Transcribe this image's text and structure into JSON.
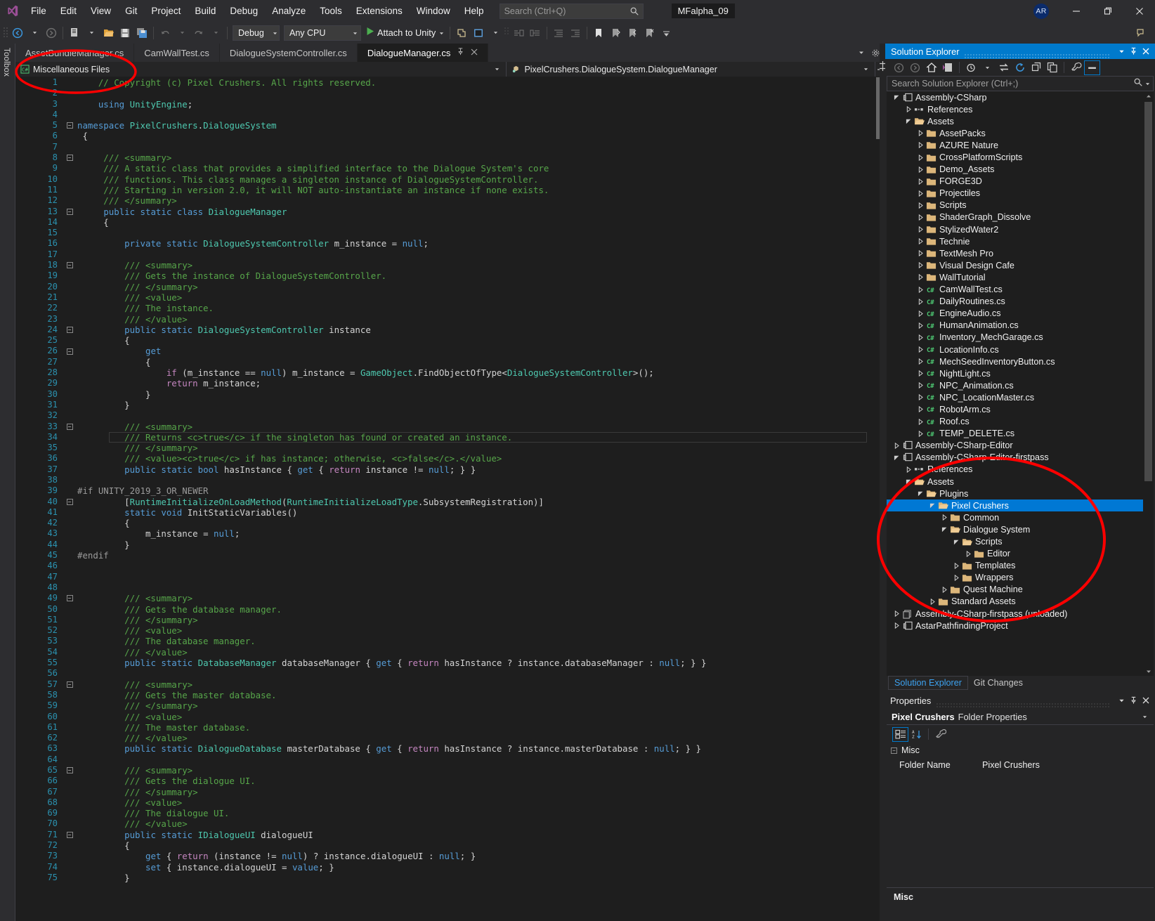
{
  "app": {
    "logo": "visual-studio-logo",
    "solution_name": "MFalpha_09",
    "avatar_initials": "AR"
  },
  "menu": {
    "items": [
      "File",
      "Edit",
      "View",
      "Git",
      "Project",
      "Build",
      "Debug",
      "Analyze",
      "Tools",
      "Extensions",
      "Window",
      "Help"
    ]
  },
  "search": {
    "placeholder": "Search (Ctrl+Q)",
    "value": "",
    "icon": "search-icon"
  },
  "window_controls": {
    "minimize": "—",
    "restore": "❐",
    "close": "✕"
  },
  "toolbar": {
    "nav_back": "navigate-back-icon",
    "nav_forward": "navigate-forward-icon",
    "new_item": "new-item-icon",
    "open_file": "open-file-icon",
    "save": "save-icon",
    "save_all": "save-all-icon",
    "undo": "undo-icon",
    "redo": "redo-icon",
    "config": "Debug",
    "platform": "Any CPU",
    "run_label": "Attach to Unity",
    "run_icon": "play-icon",
    "live_share": "live-share-icon",
    "preview": "preview-icon",
    "comment": "comment-icon",
    "uncomment": "uncomment-icon",
    "indent": "indent-icon",
    "outdent": "outdent-icon",
    "bookmark": "bookmark-icon",
    "bookmark_prev": "bookmark-prev-icon",
    "bookmark_next": "bookmark-next-icon",
    "bookmark_clear": "bookmark-clear-icon",
    "feedback": "feedback-icon"
  },
  "toolbox": {
    "label": "Toolbox"
  },
  "editor": {
    "tabs": [
      {
        "label": "AssetBundleManager.cs",
        "active": false
      },
      {
        "label": "CamWallTest.cs",
        "active": false
      },
      {
        "label": "DialogueSystemController.cs",
        "active": false
      },
      {
        "label": "DialogueManager.cs",
        "active": true
      }
    ],
    "tab_pin": "─□",
    "tab_close": "✕",
    "navbar": {
      "project": "Miscellaneous Files",
      "project_icon": "csharp-file-icon",
      "type": "PixelCrushers.DialogueSystem.DialogueManager",
      "type_icon": "class-icon"
    },
    "current_line": 34,
    "lines": [
      {
        "n": 1,
        "fold": "",
        "text": "    // Copyright (c) Pixel Crushers. All rights reserved.",
        "style": "cmt"
      },
      {
        "n": 2,
        "fold": "",
        "text": "",
        "style": "plain"
      },
      {
        "n": 3,
        "fold": "",
        "text": "    using UnityEngine;",
        "style": "mix"
      },
      {
        "n": 4,
        "fold": "",
        "text": "",
        "style": "plain"
      },
      {
        "n": 5,
        "fold": "-",
        "text": "namespace PixelCrushers.DialogueSystem",
        "style": "mix"
      },
      {
        "n": 6,
        "fold": "",
        "text": " {",
        "style": "plain"
      },
      {
        "n": 7,
        "fold": "",
        "text": "",
        "style": "plain"
      },
      {
        "n": 8,
        "fold": "-",
        "text": "     /// <summary>",
        "style": "doc"
      },
      {
        "n": 9,
        "fold": "",
        "text": "     /// A static class that provides a simplified interface to the Dialogue System's core",
        "style": "doc"
      },
      {
        "n": 10,
        "fold": "",
        "text": "     /// functions. This class manages a singleton instance of DialogueSystemController.",
        "style": "doc"
      },
      {
        "n": 11,
        "fold": "",
        "text": "     /// Starting in version 2.0, it will NOT auto-instantiate an instance if none exists.",
        "style": "doc"
      },
      {
        "n": 12,
        "fold": "",
        "text": "     /// </summary>",
        "style": "doc"
      },
      {
        "n": 13,
        "fold": "-",
        "text": "     public static class DialogueManager",
        "style": "mix"
      },
      {
        "n": 14,
        "fold": "",
        "text": "     {",
        "style": "plain"
      },
      {
        "n": 15,
        "fold": "",
        "text": "",
        "style": "plain"
      },
      {
        "n": 16,
        "fold": "",
        "text": "         private static DialogueSystemController m_instance = null;",
        "style": "mix"
      },
      {
        "n": 17,
        "fold": "",
        "text": "",
        "style": "plain"
      },
      {
        "n": 18,
        "fold": "-",
        "text": "         /// <summary>",
        "style": "doc"
      },
      {
        "n": 19,
        "fold": "",
        "text": "         /// Gets the instance of DialogueSystemController.",
        "style": "doc"
      },
      {
        "n": 20,
        "fold": "",
        "text": "         /// </summary>",
        "style": "doc"
      },
      {
        "n": 21,
        "fold": "",
        "text": "         /// <value>",
        "style": "doc"
      },
      {
        "n": 22,
        "fold": "",
        "text": "         /// The instance.",
        "style": "doc"
      },
      {
        "n": 23,
        "fold": "",
        "text": "         /// </value>",
        "style": "doc"
      },
      {
        "n": 24,
        "fold": "-",
        "text": "         public static DialogueSystemController instance",
        "style": "mix"
      },
      {
        "n": 25,
        "fold": "",
        "text": "         {",
        "style": "plain"
      },
      {
        "n": 26,
        "fold": "-",
        "text": "             get",
        "style": "mix"
      },
      {
        "n": 27,
        "fold": "",
        "text": "             {",
        "style": "plain"
      },
      {
        "n": 28,
        "fold": "",
        "text": "                 if (m_instance == null) m_instance = GameObject.FindObjectOfType<DialogueSystemController>();",
        "style": "mix"
      },
      {
        "n": 29,
        "fold": "",
        "text": "                 return m_instance;",
        "style": "mix"
      },
      {
        "n": 30,
        "fold": "",
        "text": "             }",
        "style": "plain"
      },
      {
        "n": 31,
        "fold": "",
        "text": "         }",
        "style": "plain"
      },
      {
        "n": 32,
        "fold": "",
        "text": "",
        "style": "plain"
      },
      {
        "n": 33,
        "fold": "-",
        "text": "         /// <summary>",
        "style": "doc"
      },
      {
        "n": 34,
        "fold": "",
        "text": "         /// Returns <c>true</c> if the singleton has found or created an instance.",
        "style": "doc"
      },
      {
        "n": 35,
        "fold": "",
        "text": "         /// </summary>",
        "style": "doc"
      },
      {
        "n": 36,
        "fold": "",
        "text": "         /// <value><c>true</c> if has instance; otherwise, <c>false</c>.</value>",
        "style": "doc"
      },
      {
        "n": 37,
        "fold": "",
        "text": "         public static bool hasInstance { get { return instance != null; } }",
        "style": "mix"
      },
      {
        "n": 38,
        "fold": "",
        "text": "",
        "style": "plain"
      },
      {
        "n": 39,
        "fold": "",
        "text": "#if UNITY_2019_3_OR_NEWER",
        "style": "pp"
      },
      {
        "n": 40,
        "fold": "-",
        "text": "         [RuntimeInitializeOnLoadMethod(RuntimeInitializeLoadType.SubsystemRegistration)]",
        "style": "mix"
      },
      {
        "n": 41,
        "fold": "",
        "text": "         static void InitStaticVariables()",
        "style": "mix"
      },
      {
        "n": 42,
        "fold": "",
        "text": "         {",
        "style": "plain"
      },
      {
        "n": 43,
        "fold": "",
        "text": "             m_instance = null;",
        "style": "mix"
      },
      {
        "n": 44,
        "fold": "",
        "text": "         }",
        "style": "plain"
      },
      {
        "n": 45,
        "fold": "",
        "text": "#endif",
        "style": "pp"
      },
      {
        "n": 46,
        "fold": "",
        "text": "",
        "style": "plain"
      },
      {
        "n": 47,
        "fold": "",
        "text": "",
        "style": "plain"
      },
      {
        "n": 48,
        "fold": "",
        "text": "",
        "style": "plain"
      },
      {
        "n": 49,
        "fold": "-",
        "text": "         /// <summary>",
        "style": "doc"
      },
      {
        "n": 50,
        "fold": "",
        "text": "         /// Gets the database manager.",
        "style": "doc"
      },
      {
        "n": 51,
        "fold": "",
        "text": "         /// </summary>",
        "style": "doc"
      },
      {
        "n": 52,
        "fold": "",
        "text": "         /// <value>",
        "style": "doc"
      },
      {
        "n": 53,
        "fold": "",
        "text": "         /// The database manager.",
        "style": "doc"
      },
      {
        "n": 54,
        "fold": "",
        "text": "         /// </value>",
        "style": "doc"
      },
      {
        "n": 55,
        "fold": "",
        "text": "         public static DatabaseManager databaseManager { get { return hasInstance ? instance.databaseManager : null; } }",
        "style": "mix"
      },
      {
        "n": 56,
        "fold": "",
        "text": "",
        "style": "plain"
      },
      {
        "n": 57,
        "fold": "-",
        "text": "         /// <summary>",
        "style": "doc"
      },
      {
        "n": 58,
        "fold": "",
        "text": "         /// Gets the master database.",
        "style": "doc"
      },
      {
        "n": 59,
        "fold": "",
        "text": "         /// </summary>",
        "style": "doc"
      },
      {
        "n": 60,
        "fold": "",
        "text": "         /// <value>",
        "style": "doc"
      },
      {
        "n": 61,
        "fold": "",
        "text": "         /// The master database.",
        "style": "doc"
      },
      {
        "n": 62,
        "fold": "",
        "text": "         /// </value>",
        "style": "doc"
      },
      {
        "n": 63,
        "fold": "",
        "text": "         public static DialogueDatabase masterDatabase { get { return hasInstance ? instance.masterDatabase : null; } }",
        "style": "mix"
      },
      {
        "n": 64,
        "fold": "",
        "text": "",
        "style": "plain"
      },
      {
        "n": 65,
        "fold": "-",
        "text": "         /// <summary>",
        "style": "doc"
      },
      {
        "n": 66,
        "fold": "",
        "text": "         /// Gets the dialogue UI.",
        "style": "doc"
      },
      {
        "n": 67,
        "fold": "",
        "text": "         /// </summary>",
        "style": "doc"
      },
      {
        "n": 68,
        "fold": "",
        "text": "         /// <value>",
        "style": "doc"
      },
      {
        "n": 69,
        "fold": "",
        "text": "         /// The dialogue UI.",
        "style": "doc"
      },
      {
        "n": 70,
        "fold": "",
        "text": "         /// </value>",
        "style": "doc"
      },
      {
        "n": 71,
        "fold": "-",
        "text": "         public static IDialogueUI dialogueUI",
        "style": "mix"
      },
      {
        "n": 72,
        "fold": "",
        "text": "         {",
        "style": "plain"
      },
      {
        "n": 73,
        "fold": "",
        "text": "             get { return (instance != null) ? instance.dialogueUI : null; }",
        "style": "mix"
      },
      {
        "n": 74,
        "fold": "",
        "text": "             set { instance.dialogueUI = value; }",
        "style": "mix"
      },
      {
        "n": 75,
        "fold": "",
        "text": "         }",
        "style": "plain"
      }
    ]
  },
  "solution_explorer": {
    "title": "Solution Explorer",
    "header_buttons": [
      "chevron-down-icon",
      "pin-icon",
      "close-icon"
    ],
    "toolbar_icons": [
      "back-icon",
      "forward-icon",
      "home-icon",
      "sync-with-active-document-icon",
      "pending-changes-filter-icon",
      "sync-icon",
      "refresh-icon",
      "collapse-all-icon",
      "show-all-files-icon",
      "properties-icon",
      "preview-selected-items-icon"
    ],
    "search_placeholder": "Search Solution Explorer (Ctrl+;)",
    "search_value": "",
    "search_icon": "search-icon",
    "tree": [
      {
        "depth": 0,
        "exp": "open",
        "icon": "project",
        "label": "Assembly-CSharp"
      },
      {
        "depth": 1,
        "exp": "closed",
        "icon": "references",
        "label": "References"
      },
      {
        "depth": 1,
        "exp": "open",
        "icon": "folderopen",
        "label": "Assets"
      },
      {
        "depth": 2,
        "exp": "closed",
        "icon": "folder",
        "label": "AssetPacks"
      },
      {
        "depth": 2,
        "exp": "closed",
        "icon": "folder",
        "label": "AZURE Nature"
      },
      {
        "depth": 2,
        "exp": "closed",
        "icon": "folder",
        "label": "CrossPlatformScripts"
      },
      {
        "depth": 2,
        "exp": "closed",
        "icon": "folder",
        "label": "Demo_Assets"
      },
      {
        "depth": 2,
        "exp": "closed",
        "icon": "folder",
        "label": "FORGE3D"
      },
      {
        "depth": 2,
        "exp": "closed",
        "icon": "folder",
        "label": "Projectiles"
      },
      {
        "depth": 2,
        "exp": "closed",
        "icon": "folder",
        "label": "Scripts"
      },
      {
        "depth": 2,
        "exp": "closed",
        "icon": "folder",
        "label": "ShaderGraph_Dissolve"
      },
      {
        "depth": 2,
        "exp": "closed",
        "icon": "folder",
        "label": "StylizedWater2"
      },
      {
        "depth": 2,
        "exp": "closed",
        "icon": "folder",
        "label": "Technie"
      },
      {
        "depth": 2,
        "exp": "closed",
        "icon": "folder",
        "label": "TextMesh Pro"
      },
      {
        "depth": 2,
        "exp": "closed",
        "icon": "folder",
        "label": "Visual Design Cafe"
      },
      {
        "depth": 2,
        "exp": "closed",
        "icon": "folder",
        "label": "WallTutorial"
      },
      {
        "depth": 2,
        "exp": "closed",
        "icon": "cs",
        "label": "CamWallTest.cs"
      },
      {
        "depth": 2,
        "exp": "closed",
        "icon": "cs",
        "label": "DailyRoutines.cs"
      },
      {
        "depth": 2,
        "exp": "closed",
        "icon": "cs",
        "label": "EngineAudio.cs"
      },
      {
        "depth": 2,
        "exp": "closed",
        "icon": "cs",
        "label": "HumanAnimation.cs"
      },
      {
        "depth": 2,
        "exp": "closed",
        "icon": "cs",
        "label": "Inventory_MechGarage.cs"
      },
      {
        "depth": 2,
        "exp": "closed",
        "icon": "cs",
        "label": "LocationInfo.cs"
      },
      {
        "depth": 2,
        "exp": "closed",
        "icon": "cs",
        "label": "MechSeedInventoryButton.cs"
      },
      {
        "depth": 2,
        "exp": "closed",
        "icon": "cs",
        "label": "NightLight.cs"
      },
      {
        "depth": 2,
        "exp": "closed",
        "icon": "cs",
        "label": "NPC_Animation.cs"
      },
      {
        "depth": 2,
        "exp": "closed",
        "icon": "cs",
        "label": "NPC_LocationMaster.cs"
      },
      {
        "depth": 2,
        "exp": "closed",
        "icon": "cs",
        "label": "RobotArm.cs"
      },
      {
        "depth": 2,
        "exp": "closed",
        "icon": "cs",
        "label": "Roof.cs"
      },
      {
        "depth": 2,
        "exp": "closed",
        "icon": "cs",
        "label": "TEMP_DELETE.cs"
      },
      {
        "depth": 0,
        "exp": "closed",
        "icon": "project",
        "label": "Assembly-CSharp-Editor"
      },
      {
        "depth": 0,
        "exp": "open",
        "icon": "project",
        "label": "Assembly-CSharp-Editor-firstpass"
      },
      {
        "depth": 1,
        "exp": "closed",
        "icon": "references",
        "label": "References"
      },
      {
        "depth": 1,
        "exp": "open",
        "icon": "folderopen",
        "label": "Assets"
      },
      {
        "depth": 2,
        "exp": "open",
        "icon": "folderopen",
        "label": "Plugins"
      },
      {
        "depth": 3,
        "exp": "open",
        "icon": "folderopen",
        "label": "Pixel Crushers",
        "selected": true
      },
      {
        "depth": 4,
        "exp": "closed",
        "icon": "folder",
        "label": "Common"
      },
      {
        "depth": 4,
        "exp": "open",
        "icon": "folderopen",
        "label": "Dialogue System"
      },
      {
        "depth": 5,
        "exp": "open",
        "icon": "folderopen",
        "label": "Scripts"
      },
      {
        "depth": 6,
        "exp": "closed",
        "icon": "folder",
        "label": "Editor"
      },
      {
        "depth": 5,
        "exp": "closed",
        "icon": "folder",
        "label": "Templates"
      },
      {
        "depth": 5,
        "exp": "closed",
        "icon": "folder",
        "label": "Wrappers"
      },
      {
        "depth": 4,
        "exp": "closed",
        "icon": "folder",
        "label": "Quest Machine"
      },
      {
        "depth": 3,
        "exp": "closed",
        "icon": "folder",
        "label": "Standard Assets"
      },
      {
        "depth": 0,
        "exp": "closed",
        "icon": "unloaded",
        "label": "Assembly-CSharp-firstpass (unloaded)"
      },
      {
        "depth": 0,
        "exp": "closed",
        "icon": "project",
        "label": "AstarPathfindingProject"
      }
    ],
    "bottom_tabs": [
      {
        "label": "Solution Explorer",
        "active": true
      },
      {
        "label": "Git Changes",
        "active": false
      }
    ]
  },
  "properties": {
    "title": "Properties",
    "header_buttons": [
      "chevron-down-icon",
      "pin-icon",
      "close-icon"
    ],
    "selected_object": "Pixel Crushers",
    "selected_kind": "Folder Properties",
    "toolbar_icons": [
      "categorized-icon",
      "alphabetical-icon",
      "property-pages-icon"
    ],
    "category": "Misc",
    "rows": [
      {
        "name": "Folder Name",
        "value": "Pixel Crushers"
      }
    ],
    "footer_title": "Misc"
  },
  "annotations": {
    "accent": "#ff0000",
    "ellipses": [
      {
        "name": "misc-files-highlight"
      },
      {
        "name": "pixel-crushers-highlight"
      }
    ]
  },
  "colors": {
    "accent_blue": "#007acc",
    "selection_blue": "#0078d4",
    "editor_bg": "#1e1e1e",
    "chrome_bg": "#2d2d30",
    "panel_bg": "#252526",
    "comment_green": "#57a64a",
    "keyword_blue": "#569cd6",
    "type_teal": "#4ec9b0",
    "linenum_blue": "#2b91af",
    "annotation_red": "#ff0000"
  }
}
